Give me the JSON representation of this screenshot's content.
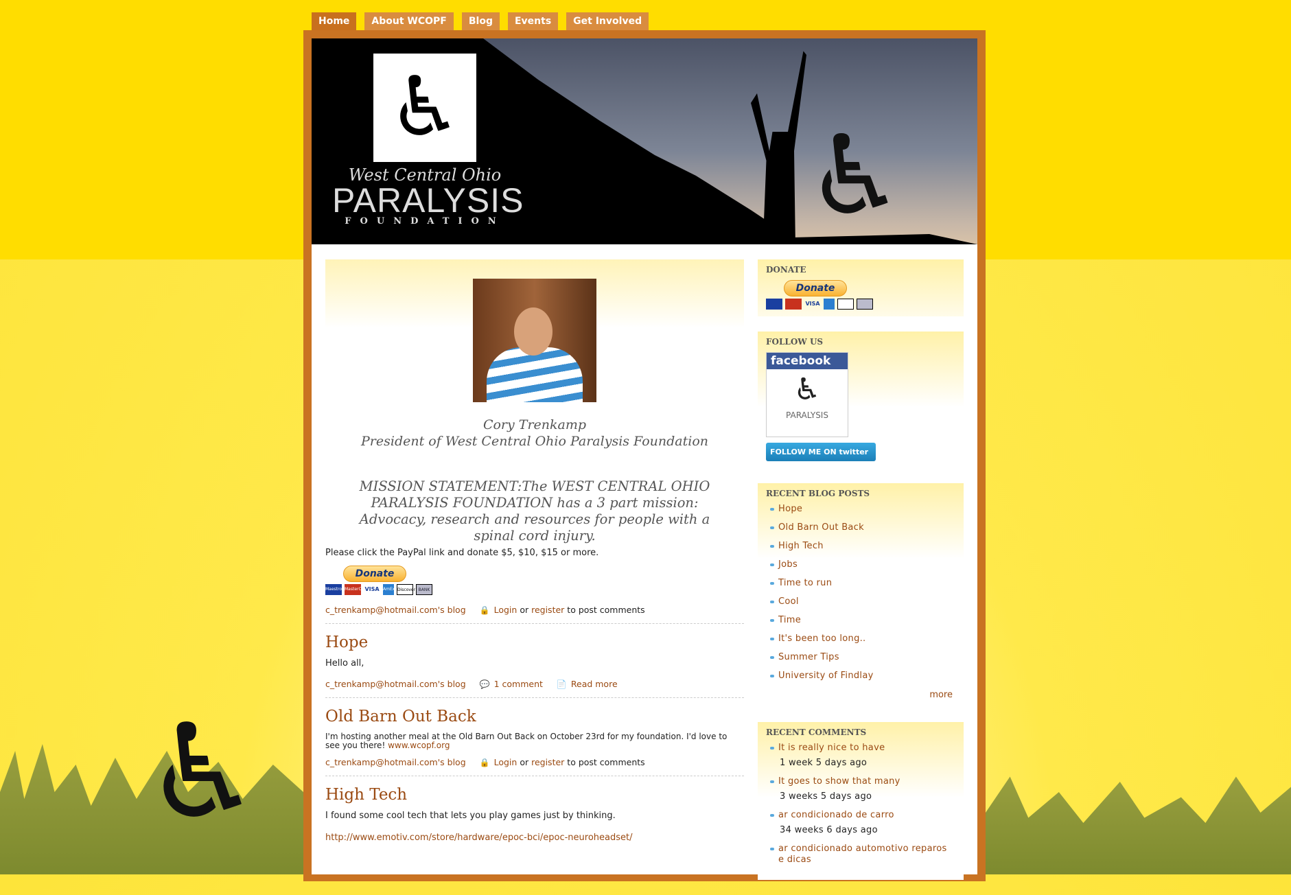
{
  "nav": [
    {
      "label": "Home",
      "active": true
    },
    {
      "label": "About WCOPF"
    },
    {
      "label": "Blog"
    },
    {
      "label": "Events"
    },
    {
      "label": "Get Involved"
    }
  ],
  "logo": {
    "line1": "West Central Ohio",
    "line2": "PARALYSIS",
    "line3": "FOUNDATION"
  },
  "intro": {
    "name": "Cory Trenkamp",
    "role": "President of West Central Ohio Paralysis Foundation",
    "mission": "MISSION STATEMENT:The WEST CENTRAL OHIO PARALYSIS FOUNDATION has a 3 part mission: Advocacy, research and resources for people with a spinal cord injury.",
    "paypal_text": "Please click the PayPal link and donate $5, $10, $15 or more."
  },
  "donate_label": "Donate",
  "cards": [
    "Maestro",
    "MasterCard",
    "VISA",
    "AmEx",
    "Discover",
    "BANK"
  ],
  "links": {
    "blog": "c_trenkamp@hotmail.com's blog",
    "login": "Login",
    "or": "or",
    "register": "register",
    "to_post": "to post comments",
    "comment": "1 comment",
    "read_more": "Read more"
  },
  "posts": [
    {
      "title": "Hope",
      "body": "Hello all,"
    },
    {
      "title": "Old Barn Out Back",
      "body": "I'm hosting another meal at the Old Barn Out Back on October 23rd for my foundation. I'd love to see you there!",
      "link": "www.wcopf.org"
    },
    {
      "title": "High Tech",
      "body": "I found some cool tech that lets you play games just by thinking.",
      "link": "http://www.emotiv.com/store/hardware/epoc-bci/epoc-neuroheadset/"
    }
  ],
  "sidebar": {
    "donate_title": "DONATE",
    "follow_title": "FOLLOW US",
    "facebook": "facebook",
    "twitter": "FOLLOW ME ON twitter",
    "recent_title": "RECENT BLOG POSTS",
    "recent": [
      "Hope",
      "Old Barn Out Back",
      "High Tech",
      "Jobs",
      "Time to run",
      "Cool",
      "Time",
      "It's been too long..",
      "Summer Tips",
      "University of Findlay"
    ],
    "more": "more",
    "comments_title": "RECENT COMMENTS",
    "comments": [
      {
        "text": "It is really nice to have",
        "ago": "1 week 5 days ago"
      },
      {
        "text": "It goes to show that many",
        "ago": "3 weeks 5 days ago"
      },
      {
        "text": "ar condicionado de carro",
        "ago": "34 weeks 6 days ago"
      },
      {
        "text": "ar condicionado automotivo reparos e dicas"
      }
    ]
  }
}
